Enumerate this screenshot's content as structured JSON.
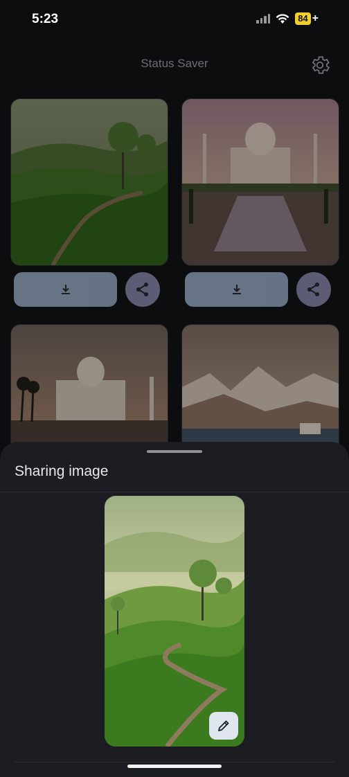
{
  "status_bar": {
    "time": "5:23",
    "battery": "84",
    "icons": [
      "signal-icon",
      "wifi-icon",
      "battery-icon",
      "charging-icon"
    ]
  },
  "header": {
    "title": "Status Saver",
    "settings_icon": "gear-icon"
  },
  "cards": [
    {
      "name": "tea-plantation",
      "download_icon": "download-icon",
      "share_icon": "share-icon"
    },
    {
      "name": "taj-mahal-reflection",
      "download_icon": "download-icon",
      "share_icon": "share-icon"
    },
    {
      "name": "taj-mahal-palms"
    },
    {
      "name": "mountain-lake"
    }
  ],
  "sheet": {
    "title": "Sharing image",
    "edit_icon": "pencil-icon"
  },
  "colors": {
    "background": "#0c0d0f",
    "sheet": "#1b1d22",
    "download_button": "#76869a",
    "share_button": "#6a6a86",
    "battery": "#f2d02b"
  }
}
